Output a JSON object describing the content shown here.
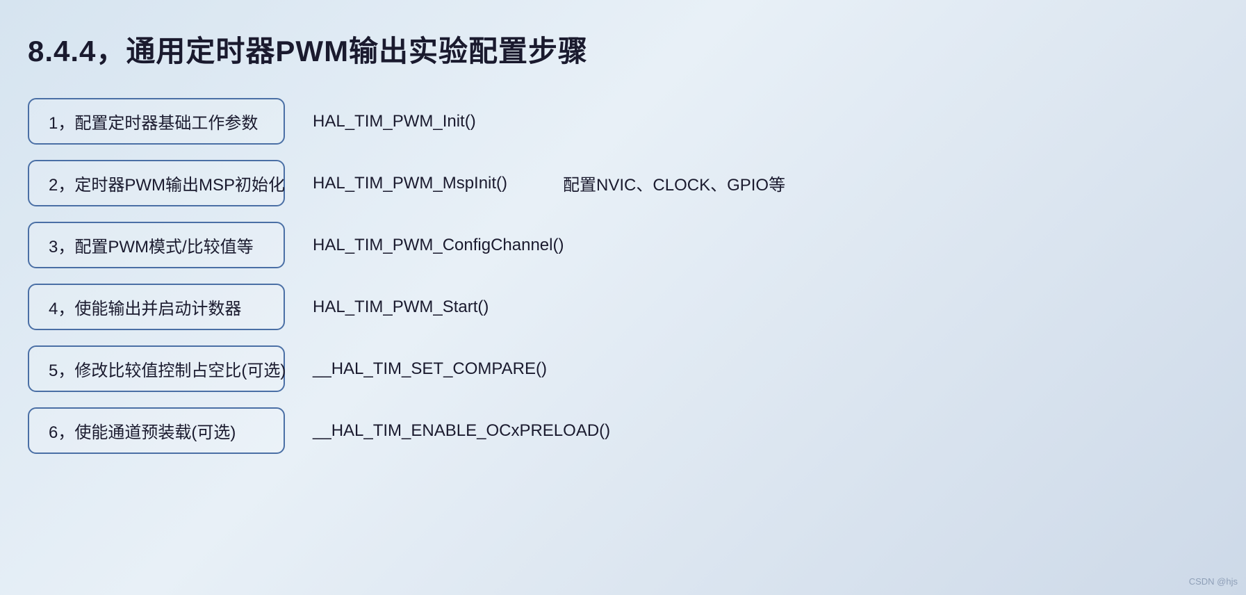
{
  "title": "8.4.4，通用定时器PWM输出实验配置步骤",
  "steps": [
    {
      "id": 1,
      "box_label": "1，配置定时器基础工作参数",
      "function": "HAL_TIM_PWM_Init()",
      "extra": ""
    },
    {
      "id": 2,
      "box_label": "2，定时器PWM输出MSP初始化",
      "function": "HAL_TIM_PWM_MspInit()",
      "extra": "配置NVIC、CLOCK、GPIO等"
    },
    {
      "id": 3,
      "box_label": "3，配置PWM模式/比较值等",
      "function": "HAL_TIM_PWM_ConfigChannel()",
      "extra": ""
    },
    {
      "id": 4,
      "box_label": "4，使能输出并启动计数器",
      "function": "HAL_TIM_PWM_Start()",
      "extra": ""
    },
    {
      "id": 5,
      "box_label": "5，修改比较值控制占空比(可选)",
      "function": "__HAL_TIM_SET_COMPARE()",
      "extra": ""
    },
    {
      "id": 6,
      "box_label": "6，使能通道预装载(可选)",
      "function": "__HAL_TIM_ENABLE_OCxPRELOAD()",
      "extra": ""
    }
  ],
  "watermark": "CSDN @hjs"
}
